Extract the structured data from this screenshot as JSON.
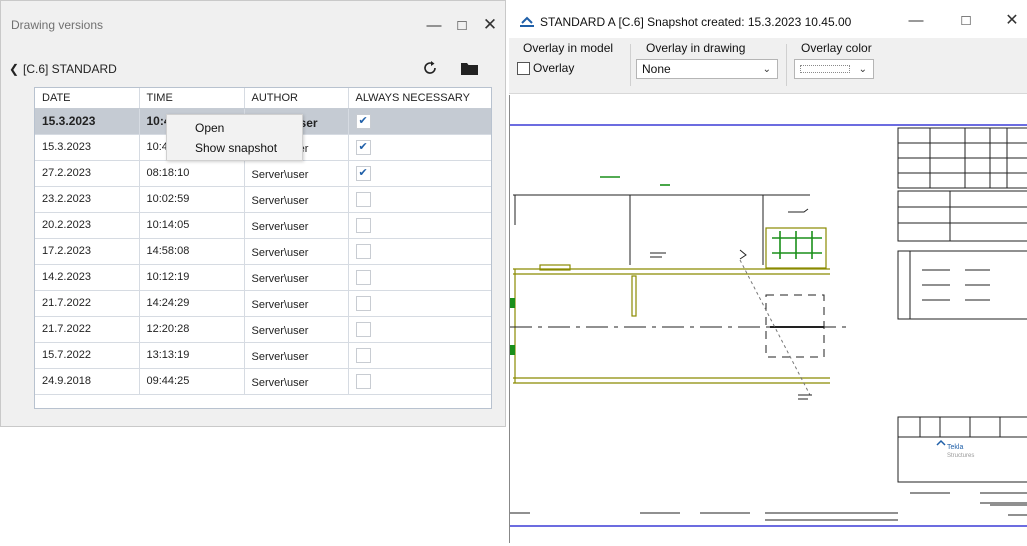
{
  "versions_window": {
    "title": "Drawing versions",
    "path": "[C.6] STANDARD",
    "columns": [
      "DATE",
      "TIME",
      "AUTHOR",
      "ALWAYS NECESSARY"
    ],
    "rows": [
      {
        "date": "15.3.2023",
        "time": "10:45:00",
        "author": "Server\\user",
        "always_necessary": true
      },
      {
        "date": "15.3.2023",
        "time": "10:4",
        "author": "Server\\user",
        "always_necessary": true
      },
      {
        "date": "27.2.2023",
        "time": "08:18:10",
        "author": "Server\\user",
        "always_necessary": true
      },
      {
        "date": "23.2.2023",
        "time": "10:02:59",
        "author": "Server\\user",
        "always_necessary": false
      },
      {
        "date": "20.2.2023",
        "time": "10:14:05",
        "author": "Server\\user",
        "always_necessary": false
      },
      {
        "date": "17.2.2023",
        "time": "14:58:08",
        "author": "Server\\user",
        "always_necessary": false
      },
      {
        "date": "14.2.2023",
        "time": "10:12:19",
        "author": "Server\\user",
        "always_necessary": false
      },
      {
        "date": "21.7.2022",
        "time": "14:24:29",
        "author": "Server\\user",
        "always_necessary": false
      },
      {
        "date": "21.7.2022",
        "time": "12:20:28",
        "author": "Server\\user",
        "always_necessary": false
      },
      {
        "date": "15.7.2022",
        "time": "13:13:19",
        "author": "Server\\user",
        "always_necessary": false
      },
      {
        "date": "24.9.2018",
        "time": "09:44:25",
        "author": "Server\\user",
        "always_necessary": false
      }
    ],
    "selected_row": 0,
    "context_menu": {
      "open": "Open",
      "show_snapshot": "Show snapshot"
    }
  },
  "snapshot_window": {
    "title": "STANDARD A  [C.6]  Snapshot created: 15.3.2023 10.45.00",
    "overlay_in_model_label": "Overlay in model",
    "overlay_checkbox_label": "Overlay",
    "overlay_checked": false,
    "overlay_in_drawing_label": "Overlay in drawing",
    "overlay_in_drawing_value": "None",
    "overlay_color_label": "Overlay color",
    "title_block_logo_text": "Tekla Structures"
  },
  "colors": {
    "accent_blue": "#1f5fa8",
    "drawing_olive": "#8a8a00",
    "drawing_green": "#1a8f1a",
    "frame_blue": "#3b3bd6"
  }
}
